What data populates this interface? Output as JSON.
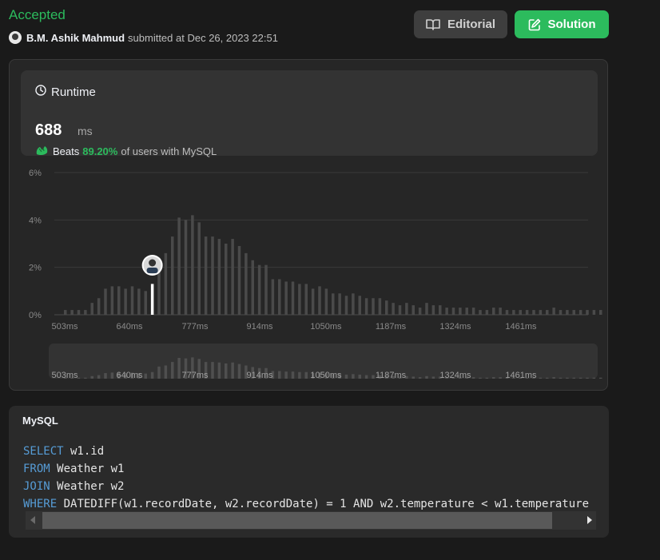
{
  "header": {
    "status": "Accepted",
    "user": "B.M. Ashik Mahmud",
    "submitted_text": "submitted at Dec 26, 2023 22:51",
    "editorial_label": "Editorial",
    "solution_label": "Solution",
    "status_color": "#2cbb5d"
  },
  "runtime": {
    "title": "Runtime",
    "value": "688",
    "unit": "ms",
    "beats_label": "Beats",
    "beats_pct": "89.20%",
    "beats_suffix": "of users with MySQL"
  },
  "chart_data": {
    "type": "bar",
    "yticks": [
      "6%",
      "4%",
      "2%",
      "0%"
    ],
    "ylim": [
      0,
      6
    ],
    "xticks": [
      "503ms",
      "640ms",
      "777ms",
      "914ms",
      "1050ms",
      "1187ms",
      "1324ms",
      "1461ms"
    ],
    "values": [
      0.2,
      0.2,
      0.2,
      0.2,
      0.5,
      0.7,
      1.1,
      1.2,
      1.2,
      1.1,
      1.2,
      1.1,
      1.0,
      1.3,
      2.4,
      2.6,
      3.3,
      4.1,
      4.0,
      4.2,
      3.9,
      3.3,
      3.3,
      3.2,
      3.0,
      3.2,
      2.9,
      2.6,
      2.3,
      2.1,
      2.1,
      1.5,
      1.5,
      1.4,
      1.4,
      1.3,
      1.3,
      1.1,
      1.2,
      1.1,
      0.9,
      0.9,
      0.8,
      0.9,
      0.8,
      0.7,
      0.7,
      0.7,
      0.6,
      0.5,
      0.4,
      0.5,
      0.4,
      0.3,
      0.5,
      0.4,
      0.4,
      0.3,
      0.3,
      0.3,
      0.3,
      0.3,
      0.2,
      0.2,
      0.3,
      0.3,
      0.2,
      0.2,
      0.2,
      0.2,
      0.2,
      0.2,
      0.2,
      0.3,
      0.2,
      0.2,
      0.2,
      0.2,
      0.2,
      0.2,
      0.2
    ],
    "user_bar_index": 13,
    "grid": true,
    "bar_color": "#4a4a4a",
    "user_color": "#ffffff"
  },
  "code_card": {
    "language": "MySQL",
    "lines": [
      {
        "kw": "SELECT",
        "rest": " w1.id"
      },
      {
        "kw": "FROM",
        "rest": " Weather w1"
      },
      {
        "kw": "JOIN",
        "rest": " Weather w2"
      },
      {
        "kw": "WHERE",
        "rest": " DATEDIFF(w1.recordDate, w2.recordDate) = 1 AND w2.temperature < w1.temperature"
      }
    ],
    "keyword_color": "#569cd6"
  }
}
